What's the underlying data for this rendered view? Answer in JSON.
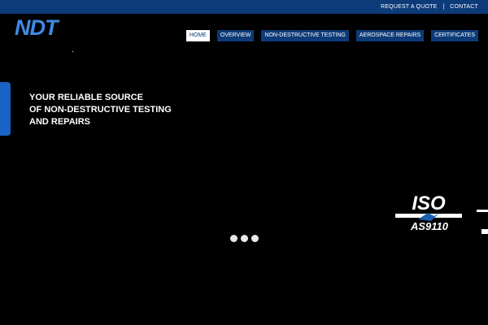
{
  "topbar": {
    "links": [
      "REQUEST A QUOTE",
      "CONTACT"
    ],
    "separator": "|"
  },
  "logo": {
    "text": "NDT"
  },
  "nav": {
    "items": [
      "HOME",
      "OVERVIEW",
      "NON-DESTRUCTIVE TESTING",
      "AEROSPACE REPAIRS",
      "CERTIFICATES"
    ],
    "active": "HOME"
  },
  "hero": {
    "lines": [
      "YOUR RELIABLE SOURCE",
      "OF NON-DESTRUCTIVE TESTING",
      "AND REPAIRS"
    ]
  },
  "badge": {
    "big_text": "ISO",
    "small_text": "AS9110"
  },
  "colors": {
    "brand_blue": "#0d3b79",
    "logo_blue": "#3f8be6",
    "accent_blue": "#1a63c6",
    "background": "#000000"
  },
  "slider": {
    "slide_count": 3
  }
}
